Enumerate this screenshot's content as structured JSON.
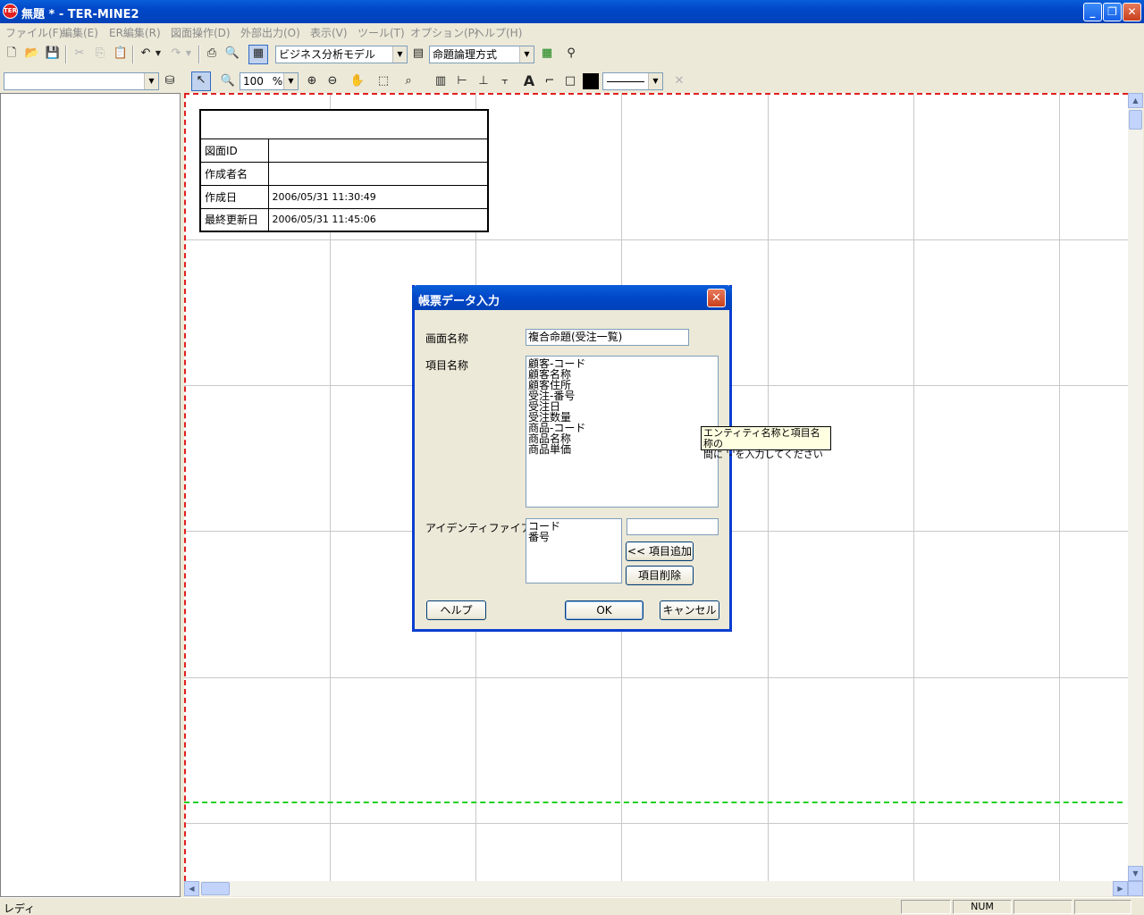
{
  "window": {
    "title": "無題 * - TER-MINE2",
    "app_icon_text": "TER"
  },
  "menu": {
    "items": [
      "ファイル(F)",
      "編集(E)",
      "ER編集(R)",
      "図面操作(D)",
      "外部出力(O)",
      "表示(V)",
      "ツール(T)",
      "オプション(P)",
      "ヘルプ(H)"
    ]
  },
  "toolbar": {
    "model_select": "ビジネス分析モデル",
    "method_select": "命題論理方式",
    "zoom_value": "100",
    "zoom_unit": "%"
  },
  "info_table": {
    "rows": [
      {
        "label": "図面ID",
        "value": ""
      },
      {
        "label": "作成者名",
        "value": ""
      },
      {
        "label": "作成日",
        "value": "2006/05/31 11:30:49"
      },
      {
        "label": "最終更新日",
        "value": "2006/05/31 11:45:06"
      }
    ]
  },
  "dialog": {
    "title": "帳票データ入力",
    "screen_name_label": "画面名称",
    "screen_name_value": "複合命題(受注一覧)",
    "item_name_label": "項目名称",
    "items": [
      "顧客-コード",
      "顧客名称",
      "顧客住所",
      "受注-番号",
      "受注日",
      "受注数量",
      "商品-コード",
      "商品名称",
      "商品単価"
    ],
    "identifier_key_label": "アイデンティファイアキー",
    "identifiers": [
      "コード",
      "番号"
    ],
    "identifier_input_value": "",
    "add_item_button": "<< 項目追加",
    "delete_item_button": "項目削除",
    "help_button": "ヘルプ",
    "ok_button": "OK",
    "cancel_button": "キャンセル"
  },
  "tooltip": {
    "line1": "エンティティ名称と項目名称の",
    "line2": "間に '-'を入力してください"
  },
  "status": {
    "text": "レディ",
    "num": "NUM"
  }
}
